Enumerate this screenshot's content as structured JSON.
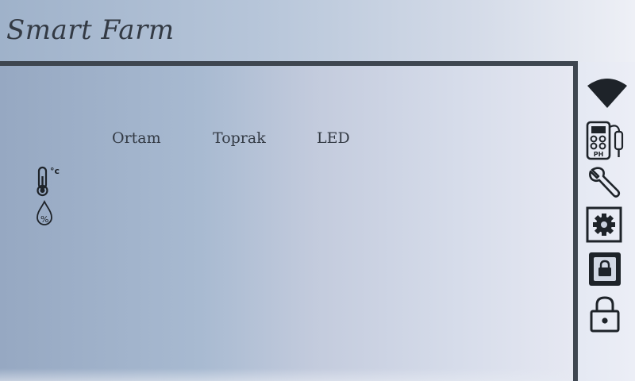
{
  "app": {
    "title": "Smart Farm"
  },
  "table": {
    "columns": [
      {
        "label": "Ortam"
      },
      {
        "label": "Toprak"
      },
      {
        "label": "LED"
      }
    ],
    "rows": [
      {
        "icon": "thermometer-celsius-icon",
        "unit": "°c"
      },
      {
        "icon": "humidity-percent-icon",
        "unit": "%"
      }
    ]
  },
  "toolbar": {
    "items": [
      {
        "icon": "wifi-icon"
      },
      {
        "icon": "ph-meter-icon",
        "label": "PH"
      },
      {
        "icon": "wrench-icon"
      },
      {
        "icon": "gear-icon"
      },
      {
        "icon": "screen-lock-icon"
      },
      {
        "icon": "padlock-icon"
      }
    ]
  },
  "colors": {
    "frame": "#3e4650",
    "icon": "#1e2329",
    "text": "#333a44"
  }
}
